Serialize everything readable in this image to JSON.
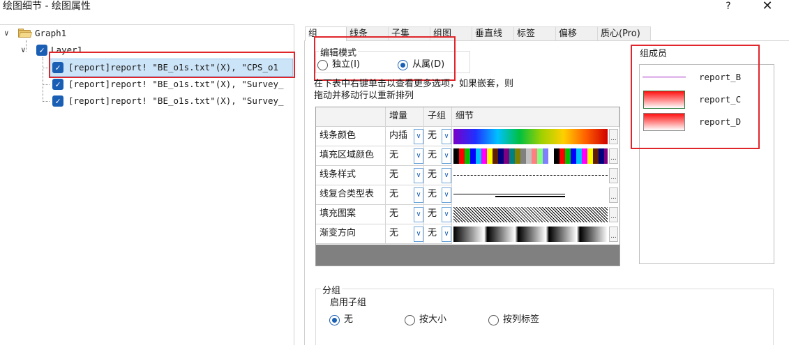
{
  "window": {
    "title": "绘图细节 - 绘图属性",
    "help_label": "?",
    "close_label": "✕"
  },
  "tree": {
    "root": "Graph1",
    "layer": "Layer1",
    "plots": [
      "[report]report! \"BE_o1s.txt\"(X), \"CPS_o1",
      "[report]report! \"BE_o1s.txt\"(X), \"Survey_",
      "[report]report! \"BE_o1s.txt\"(X), \"Survey_"
    ]
  },
  "tabs": [
    "组",
    "线条",
    "子集",
    "组图",
    "垂直线",
    "标签",
    "偏移",
    "质心(Pro)"
  ],
  "edit_mode": {
    "legend": "编辑模式",
    "options": [
      "独立(I)",
      "从属(D)"
    ],
    "selected": "从属(D)"
  },
  "hint": "在下表中右键单击以查看更多选项，如果嵌套，则拖动并移动行以重新排列",
  "grid": {
    "headers": [
      "",
      "增量",
      "子组",
      "细节"
    ],
    "rows": [
      {
        "name": "线条颜色",
        "increment": "内插",
        "subgroup": "无"
      },
      {
        "name": "填充区域颜色",
        "increment": "无",
        "subgroup": "无"
      },
      {
        "name": "线条样式",
        "increment": "无",
        "subgroup": "无"
      },
      {
        "name": "线复合类型表",
        "increment": "无",
        "subgroup": "无"
      },
      {
        "name": "填充图案",
        "increment": "无",
        "subgroup": "无"
      },
      {
        "name": "渐变方向",
        "increment": "无",
        "subgroup": "无"
      }
    ],
    "ellipsis": "..."
  },
  "members": {
    "legend": "组成员",
    "items": [
      "report_B",
      "report_C",
      "report_D"
    ],
    "line_color": "#a020c0",
    "fill_gradient_from": "#ff1010",
    "fill_gradient_to": "#ffffff"
  },
  "subgroup": {
    "legend": "分组",
    "enable_label": "启用子组",
    "options": [
      "无",
      "按大小",
      "按列标签"
    ],
    "selected": "无"
  },
  "colors": {
    "accent": "#1a5fb4",
    "highlight_border": "#e0262a",
    "selection": "#cce4f7"
  }
}
